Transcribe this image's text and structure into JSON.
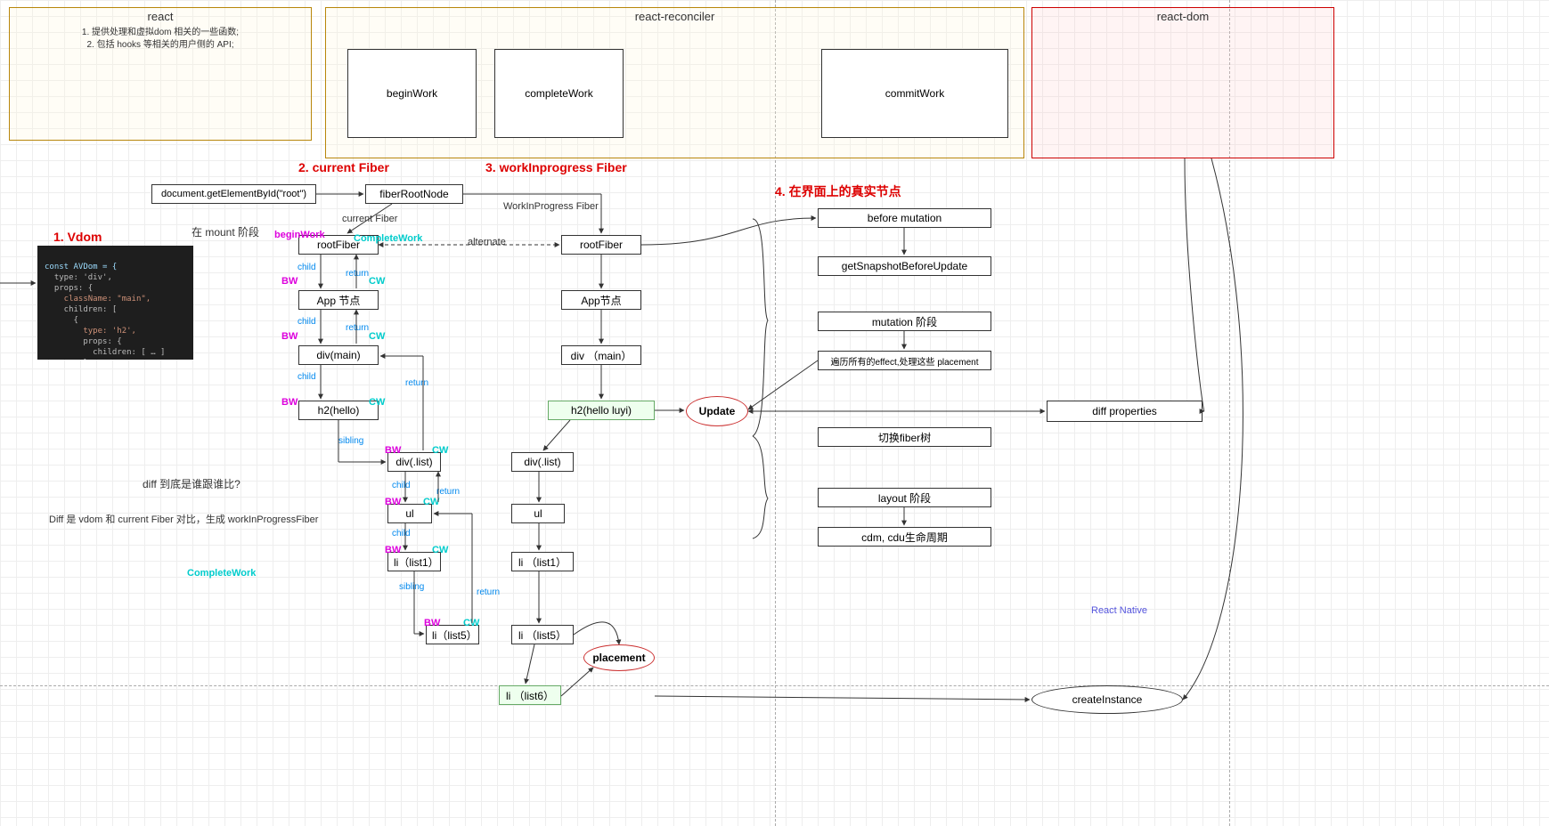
{
  "regions": {
    "react": {
      "title": "react",
      "sub1": "1. 提供处理和虚拟dom 相关的一些函数;",
      "sub2": "2. 包括 hooks 等相关的用户侧的 API;"
    },
    "reconciler": {
      "title": "react-reconciler",
      "begin": "beginWork",
      "complete": "completeWork",
      "commit": "commitWork"
    },
    "dom": {
      "title": "react-dom"
    }
  },
  "headings": {
    "vdom": "1. Vdom",
    "current": "2. current Fiber",
    "wip": "3. workInprogress Fiber",
    "realdom": "4. 在界面上的真实节点"
  },
  "column1": {
    "getel": "document.getElementById(\"root\")",
    "mount": "在 mount 阶段",
    "diffq": "diff 到底是谁跟谁比?",
    "diffa": "Diff 是 vdom  和   current Fiber 对比，生成  workInProgressFiber",
    "cw_alone": "CompleteWork"
  },
  "fiber_col2": {
    "fiberroot": "fiberRootNode",
    "rootfiber": "rootFiber",
    "app": "App 节点",
    "divmain": "div(main)",
    "h2": "h2(hello)",
    "divlist": "div(.list)",
    "ul": "ul",
    "li1": "li（list1）",
    "li5": "li（list5）"
  },
  "fiber_col3": {
    "rootfiber": "rootFiber",
    "app": "App节点",
    "divmain": "div （main）",
    "h2": "h2(hello  luyi)",
    "divlist": "div(.list)",
    "ul": "ul",
    "li1": "li （list1）",
    "li5": "li （list5）",
    "li6": "li （list6）"
  },
  "effects": {
    "update": "Update",
    "placement": "placement"
  },
  "col4": {
    "before": "before mutation",
    "snap": "getSnapshotBeforeUpdate",
    "mutation": "mutation 阶段",
    "traverse": "遍历所有的effect,处理这些 placement",
    "switch": "切换fiber树",
    "layout": "layout 阶段",
    "lifecycle": "cdm, cdu生命周期"
  },
  "col5": {
    "diffprops": "diff  properties",
    "rn": "React Native",
    "create": "createInstance"
  },
  "edge_labels": {
    "currentFiber": "current Fiber",
    "wip": "WorkInProgress Fiber",
    "alternate": "alternate",
    "child": "child",
    "return": "return",
    "sibling": "sibling",
    "beginWork": "beginWork",
    "completeWork": "CompleteWork",
    "bw": "BW",
    "cw": "CW"
  },
  "code": {
    "l1": "const AVDom = {",
    "l2": "  type: 'div',",
    "l3": "  props: {",
    "l4": "    className: \"main\",",
    "l5": "    children: [",
    "l6": "      {",
    "l7": "        type: 'h2',",
    "l8": "        props: {",
    "l9": "          children: [ … ]",
    "l10": "        }",
    "l11": "      },"
  }
}
